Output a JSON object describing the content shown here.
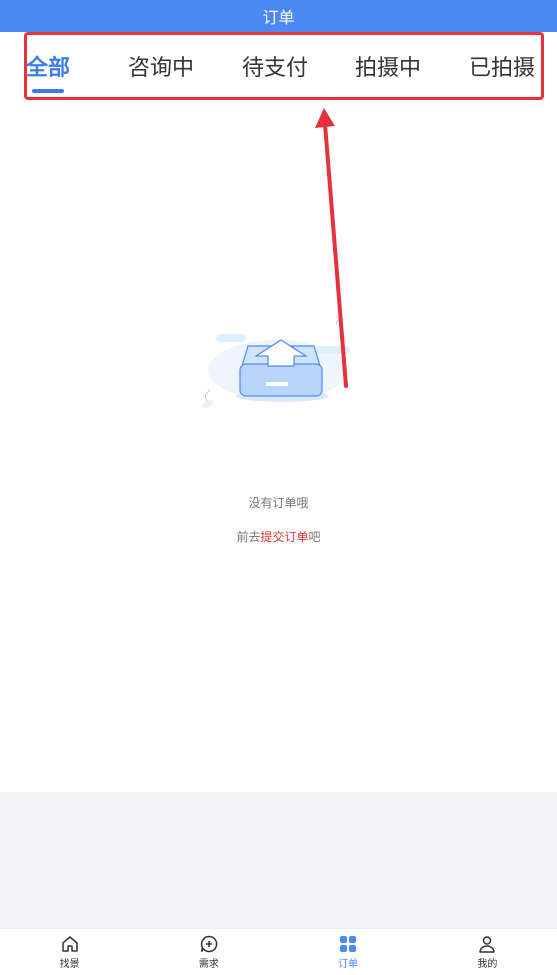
{
  "header": {
    "title": "订单"
  },
  "tabs": [
    {
      "label": "全部",
      "active": true
    },
    {
      "label": "咨询中",
      "active": false
    },
    {
      "label": "待支付",
      "active": false
    },
    {
      "label": "拍摄中",
      "active": false
    },
    {
      "label": "已拍摄",
      "active": false
    }
  ],
  "empty_state": {
    "message": "没有订单哦",
    "prompt_prefix": "前去",
    "prompt_link": "提交订单",
    "prompt_suffix": "吧"
  },
  "bottom_nav": [
    {
      "label": "找景",
      "icon": "home-icon",
      "active": false
    },
    {
      "label": "需求",
      "icon": "chat-plus-icon",
      "active": false
    },
    {
      "label": "订单",
      "icon": "grid-icon",
      "active": true
    },
    {
      "label": "我的",
      "icon": "user-icon",
      "active": false
    }
  ],
  "colors": {
    "header_bg": "#4b8af3",
    "active_tab": "#3a7ee6",
    "annotation_red": "#e4333b",
    "link_red": "#e4333b"
  }
}
